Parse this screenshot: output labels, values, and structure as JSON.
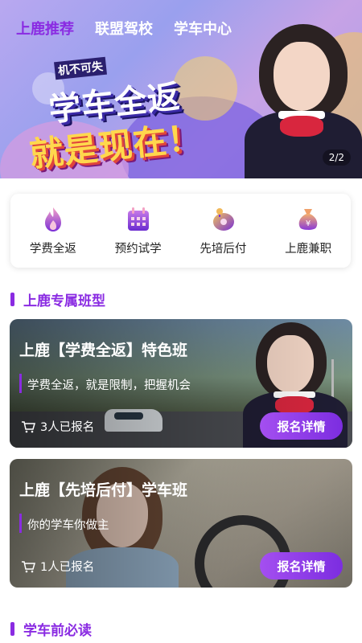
{
  "tabs": [
    {
      "label": "上鹿推荐",
      "active": true
    },
    {
      "label": "联盟驾校",
      "active": false
    },
    {
      "label": "学车中心",
      "active": false
    }
  ],
  "banner": {
    "tag": "机不可失",
    "headline": "学车全返",
    "subline": "就是现在！",
    "page_indicator": "2/2"
  },
  "quick_entries": [
    {
      "label": "学费全返",
      "icon": "flame-icon"
    },
    {
      "label": "预约试学",
      "icon": "calendar-icon"
    },
    {
      "label": "先培后付",
      "icon": "wallet-icon"
    },
    {
      "label": "上鹿兼职",
      "icon": "money-bag-icon"
    }
  ],
  "sections": {
    "exclusive": {
      "title": "上鹿专属班型"
    },
    "must_read": {
      "title": "学车前必读"
    }
  },
  "courses": [
    {
      "title": "上鹿【学费全返】特色班",
      "desc": "学费全返，就是限制，把握机会",
      "count": "3人已报名",
      "button": "报名详情"
    },
    {
      "title": "上鹿【先培后付】学车班",
      "desc": "你的学车你做主",
      "count": "1人已报名",
      "button": "报名详情"
    }
  ],
  "colors": {
    "accent": "#8a2be2",
    "button_start": "#a44ff0",
    "button_end": "#7c2de0"
  }
}
